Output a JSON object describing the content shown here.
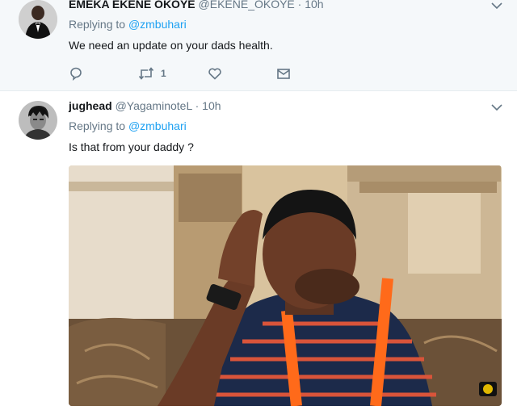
{
  "tweets": [
    {
      "fullname": "EMEKA EKENE OKOYE",
      "username": "@EKENE_OKOYE",
      "separator": "·",
      "time": "10h",
      "replying_to_label": "Replying to",
      "replying_to_handle": "@zmbuhari",
      "text": "We need an update on your dads health.",
      "actions": {
        "retweet_count": "1"
      }
    },
    {
      "fullname": "jughead",
      "username": "@YagaminoteL",
      "separator": "·",
      "time": "10h",
      "replying_to_label": "Replying to",
      "replying_to_handle": "@zmbuhari",
      "text": "Is that from your daddy ?"
    }
  ],
  "colors": {
    "link": "#1da1f2",
    "muted": "#657786",
    "text": "#14171a",
    "highlight_bg": "#f5f8fa"
  },
  "icons": [
    "reply-icon",
    "retweet-icon",
    "like-icon",
    "direct-message-icon",
    "chevron-down-icon"
  ]
}
